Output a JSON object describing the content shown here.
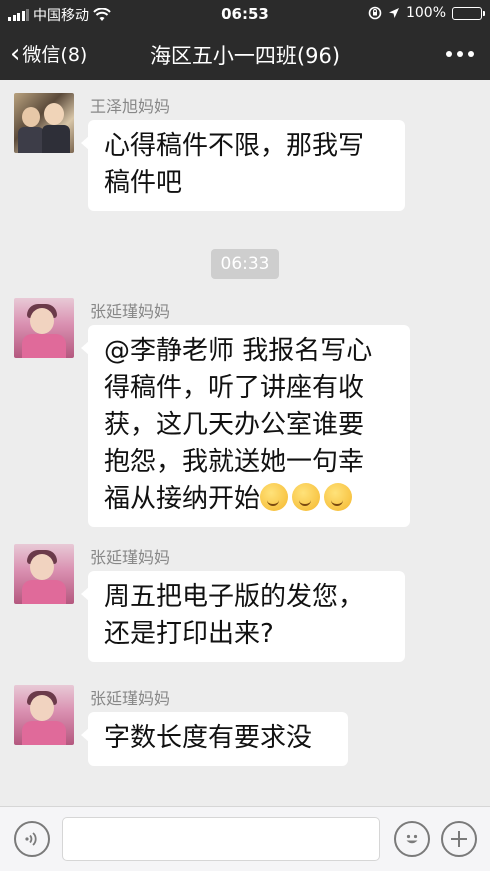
{
  "status_bar": {
    "carrier": "中国移动",
    "time": "06:53",
    "battery": "100%",
    "battery_level": 1.0
  },
  "nav": {
    "back_label": "微信(8)",
    "title": "海区五小一四班(96)"
  },
  "messages": [
    {
      "sender": "王泽旭妈妈",
      "lines": [
        "心得稿件不限，那我写",
        "稿件吧"
      ]
    },
    {
      "sender": "张延瑾妈妈",
      "lines": [
        "@李静老师 我报名写心",
        "得稿件，听了讲座有收",
        "获，这几天办公室谁要",
        "抱怨，我就送她一句幸",
        "福从接纳开始"
      ],
      "emoji_count": 3
    },
    {
      "sender": "张延瑾妈妈",
      "lines": [
        "周五把电子版的发您，",
        "还是打印出来?"
      ]
    },
    {
      "sender": "张延瑾妈妈",
      "lines": [
        "字数长度有要求没"
      ]
    }
  ],
  "timestamp": "06:33",
  "icons": {
    "voice": "voice-icon",
    "emoji": "emoji-icon",
    "plus": "plus-icon"
  }
}
